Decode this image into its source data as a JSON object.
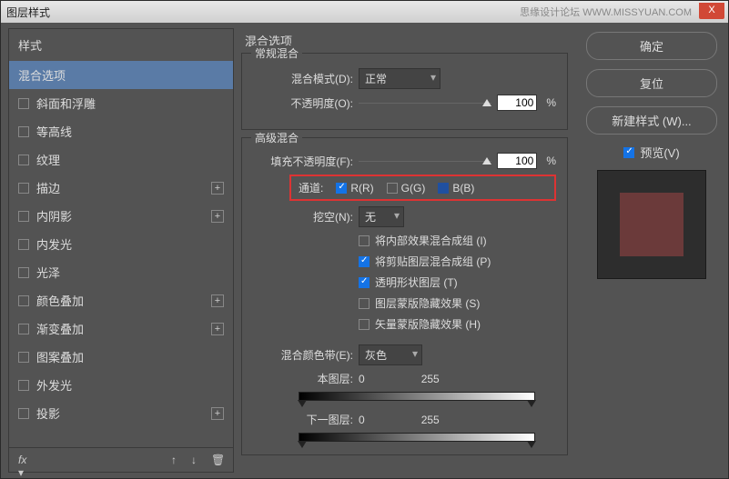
{
  "title": "图层样式",
  "watermark": "思缘设计论坛 WWW.MISSYUAN.COM",
  "close": "X",
  "sidebar": {
    "head": "样式",
    "items": [
      {
        "label": "混合选项",
        "sel": true
      },
      {
        "label": "斜面和浮雕"
      },
      {
        "label": "等高线"
      },
      {
        "label": "纹理"
      },
      {
        "label": "描边",
        "plus": true
      },
      {
        "label": "内阴影",
        "plus": true
      },
      {
        "label": "内发光"
      },
      {
        "label": "光泽"
      },
      {
        "label": "颜色叠加",
        "plus": true
      },
      {
        "label": "渐变叠加",
        "plus": true
      },
      {
        "label": "图案叠加"
      },
      {
        "label": "外发光"
      },
      {
        "label": "投影",
        "plus": true
      }
    ],
    "fx": "fx"
  },
  "main": {
    "heading": "混合选项",
    "normal": {
      "title": "常规混合",
      "mode_label": "混合模式(D):",
      "mode_value": "正常",
      "opacity_label": "不透明度(O):",
      "opacity_value": "100",
      "pct": "%"
    },
    "advanced": {
      "title": "高级混合",
      "fill_label": "填充不透明度(F):",
      "fill_value": "100",
      "pct": "%",
      "channels_label": "通道:",
      "r": "R(R)",
      "g": "G(G)",
      "b": "B(B)",
      "knockout_label": "挖空(N):",
      "knockout_value": "无",
      "opts": [
        {
          "label": "将内部效果混合成组 (I)",
          "on": false
        },
        {
          "label": "将剪贴图层混合成组 (P)",
          "on": true
        },
        {
          "label": "透明形状图层 (T)",
          "on": true
        },
        {
          "label": "图层蒙版隐藏效果 (S)",
          "on": false
        },
        {
          "label": "矢量蒙版隐藏效果 (H)",
          "on": false
        }
      ]
    },
    "blendif": {
      "label": "混合颜色带(E):",
      "value": "灰色",
      "this_label": "本图层:",
      "this_lo": "0",
      "this_hi": "255",
      "under_label": "下一图层:",
      "under_lo": "0",
      "under_hi": "255"
    }
  },
  "right": {
    "ok": "确定",
    "cancel": "复位",
    "newstyle": "新建样式 (W)...",
    "preview": "预览(V)"
  }
}
